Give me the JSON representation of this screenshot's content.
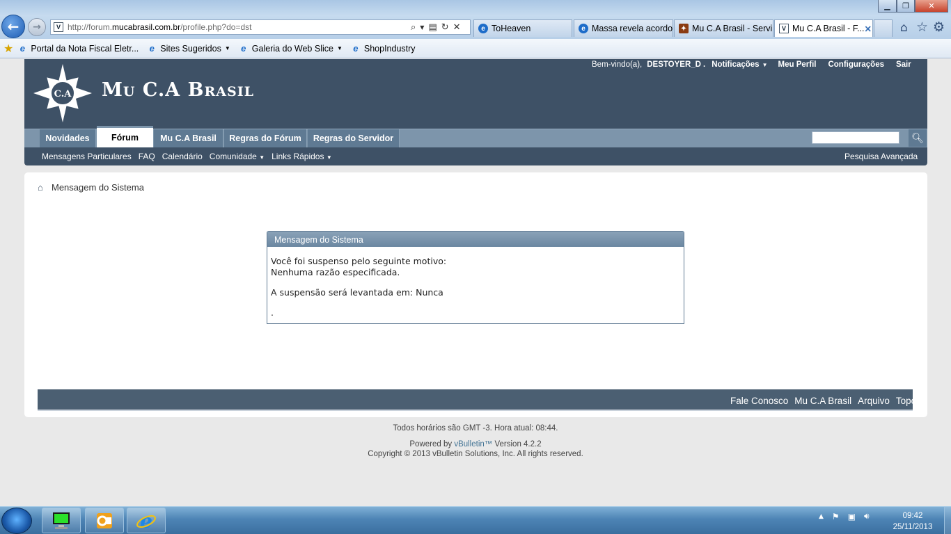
{
  "browser": {
    "address_prefix": "http://forum.",
    "address_domain": "mucabrasil.com.br",
    "address_path": "/profile.php?do=dst",
    "tabs": [
      {
        "label": "ToHeaven"
      },
      {
        "label": "Massa revela acordo..."
      },
      {
        "label": "Mu C.A Brasil - Servi..."
      },
      {
        "label": "Mu C.A Brasil - F..."
      }
    ],
    "favorites": [
      {
        "label": "Portal da Nota Fiscal Eletr..."
      },
      {
        "label": "Sites Sugeridos"
      },
      {
        "label": "Galeria do Web Slice"
      },
      {
        "label": "ShopIndustry"
      }
    ]
  },
  "site": {
    "logo_badge": "C.A",
    "logo_text": "Mu C.A Brasil",
    "welcome": "Bem-vindo(a),",
    "username": "DESTOYER_D",
    "user_links": [
      "Notificações",
      "Meu Perfil",
      "Configurações",
      "Sair"
    ],
    "nav_tabs": [
      "Novidades",
      "Fórum",
      "Mu C.A Brasil",
      "Regras do Fórum",
      "Regras do Servidor"
    ],
    "sub_nav": [
      "Mensagens Particulares",
      "FAQ",
      "Calendário",
      "Comunidade",
      "Links Rápidos"
    ],
    "advanced_search": "Pesquisa Avançada"
  },
  "breadcrumb": "Mensagem do Sistema",
  "message": {
    "title": "Mensagem do Sistema",
    "line1": "Você foi suspenso pelo seguinte motivo:",
    "line2": "Nenhuma razão especificada.",
    "line3": "A suspensão será levantada em: Nunca",
    "line4": "."
  },
  "footer": {
    "links": [
      "Fale Conosco",
      "Mu C.A Brasil",
      "Arquivo",
      "Topo"
    ],
    "timezone": "Todos horários são GMT -3. Hora atual: 08:44.",
    "powered_prefix": "Powered by ",
    "powered_link": "vBulletin™",
    "powered_suffix": " Version 4.2.2",
    "copyright": "Copyright © 2013 vBulletin Solutions, Inc. All rights reserved."
  },
  "taskbar": {
    "time": "09:42",
    "date": "25/11/2013"
  }
}
